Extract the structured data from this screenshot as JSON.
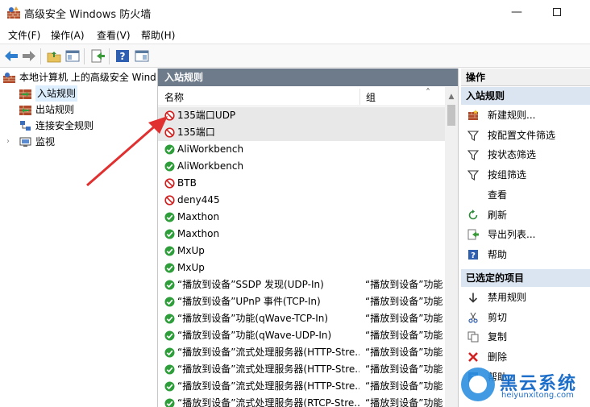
{
  "window": {
    "title": "高级安全 Windows 防火墙"
  },
  "menu": [
    {
      "label": "文件(F)"
    },
    {
      "label": "操作(A)"
    },
    {
      "label": "查看(V)"
    },
    {
      "label": "帮助(H)"
    }
  ],
  "tree": {
    "root": "本地计算机 上的高级安全 Windows",
    "items": [
      {
        "label": "入站规则",
        "selected": true
      },
      {
        "label": "出站规则"
      },
      {
        "label": "连接安全规则"
      },
      {
        "label": "监视"
      }
    ]
  },
  "middle": {
    "header": "入站规则",
    "col_name": "名称",
    "col_group": "组",
    "rows": [
      {
        "name": "135端口UDP",
        "group": "",
        "status": "blocked",
        "selected": true
      },
      {
        "name": "135端口",
        "group": "",
        "status": "blocked",
        "selected": true
      },
      {
        "name": "AliWorkbench",
        "group": "",
        "status": "allowed"
      },
      {
        "name": "AliWorkbench",
        "group": "",
        "status": "allowed"
      },
      {
        "name": "BTB",
        "group": "",
        "status": "blocked"
      },
      {
        "name": "deny445",
        "group": "",
        "status": "blocked"
      },
      {
        "name": "Maxthon",
        "group": "",
        "status": "allowed"
      },
      {
        "name": "Maxthon",
        "group": "",
        "status": "allowed"
      },
      {
        "name": "MxUp",
        "group": "",
        "status": "allowed"
      },
      {
        "name": "MxUp",
        "group": "",
        "status": "allowed"
      },
      {
        "name": "“播放到设备”SSDP 发现(UDP-In)",
        "group": "“播放到设备”功能",
        "status": "allowed"
      },
      {
        "name": "“播放到设备”UPnP 事件(TCP-In)",
        "group": "“播放到设备”功能",
        "status": "allowed"
      },
      {
        "name": "“播放到设备”功能(qWave-TCP-In)",
        "group": "“播放到设备”功能",
        "status": "allowed"
      },
      {
        "name": "“播放到设备”功能(qWave-UDP-In)",
        "group": "“播放到设备”功能",
        "status": "allowed"
      },
      {
        "name": "“播放到设备”流式处理服务器(HTTP-Stre...",
        "group": "“播放到设备”功能",
        "status": "allowed"
      },
      {
        "name": "“播放到设备”流式处理服务器(HTTP-Stre...",
        "group": "“播放到设备”功能",
        "status": "allowed"
      },
      {
        "name": "“播放到设备”流式处理服务器(HTTP-Stre...",
        "group": "“播放到设备”功能",
        "status": "allowed"
      },
      {
        "name": "“播放到设备”流式处理服务器(RTCP-Stre...",
        "group": "“播放到设备”功能",
        "status": "allowed"
      }
    ]
  },
  "actions": {
    "header": "操作",
    "section1": "入站规则",
    "items1": [
      {
        "label": "新建规则...",
        "icon": "new-rule-icon"
      },
      {
        "label": "按配置文件筛选",
        "icon": "filter-icon"
      },
      {
        "label": "按状态筛选",
        "icon": "filter-icon"
      },
      {
        "label": "按组筛选",
        "icon": "filter-icon"
      },
      {
        "label": "查看",
        "icon": ""
      },
      {
        "label": "刷新",
        "icon": "refresh-icon"
      },
      {
        "label": "导出列表...",
        "icon": "export-icon"
      },
      {
        "label": "帮助",
        "icon": "help-icon"
      }
    ],
    "section2": "已选定的项目",
    "items2": [
      {
        "label": "禁用规则",
        "icon": "disable-icon"
      },
      {
        "label": "剪切",
        "icon": "cut-icon"
      },
      {
        "label": "复制",
        "icon": "copy-icon"
      },
      {
        "label": "删除",
        "icon": "delete-icon"
      },
      {
        "label": "帮助",
        "icon": "help-icon"
      }
    ]
  },
  "watermark": {
    "title": "黑云系统",
    "url": "heiyunxitong.com"
  },
  "colors": {
    "pane_header": "#6e7b8b",
    "section_header": "#dbe5f1",
    "allowed": "#2e9e3a",
    "blocked": "#d02020",
    "arrow": "#e03030"
  }
}
